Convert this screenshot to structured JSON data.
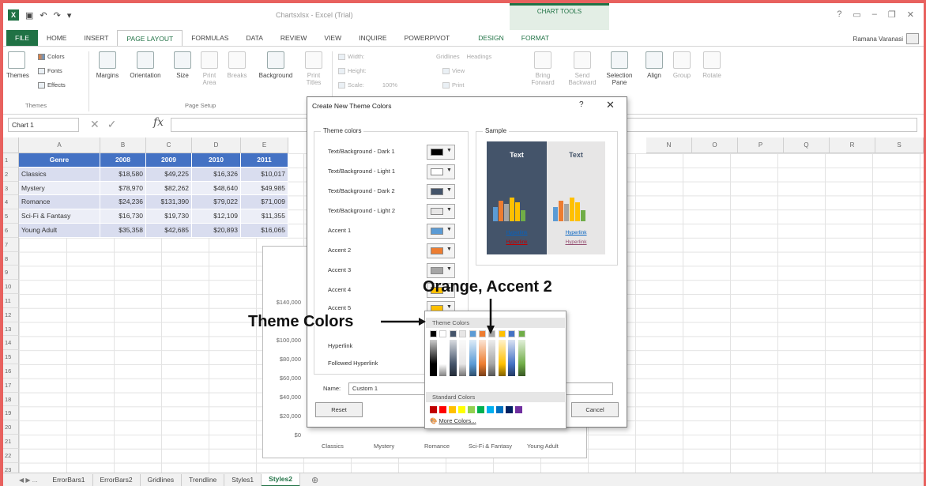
{
  "title_bar": {
    "window_title": "Chartsxlsx - Excel (Trial)",
    "chart_tools": "CHART TOOLS",
    "user": "Ramana Varanasi"
  },
  "tabs": [
    "FILE",
    "HOME",
    "INSERT",
    "PAGE LAYOUT",
    "FORMULAS",
    "DATA",
    "REVIEW",
    "VIEW",
    "INQUIRE",
    "POWERPIVOT",
    "DESIGN",
    "FORMAT"
  ],
  "ribbon": {
    "themes_label": "Themes",
    "colors": "Colors",
    "fonts": "Fonts",
    "effects": "Effects",
    "margins": "Margins",
    "orientation": "Orientation",
    "size": "Size",
    "print_area": "Print Area",
    "breaks": "Breaks",
    "background": "Background",
    "print_titles": "Print Titles",
    "page_setup_label": "Page Setup",
    "width": "Width:",
    "height": "Height:",
    "scale": "Scale:",
    "scale_value": "100%",
    "gridlines": "Gridlines",
    "headings": "Headings",
    "view": "View",
    "print": "Print",
    "bring_forward": "Bring Forward",
    "send_backward": "Send Backward",
    "selection_pane": "Selection Pane",
    "align": "Align",
    "group": "Group",
    "rotate": "Rotate"
  },
  "formula_bar": {
    "name_box": "Chart 1",
    "fx": "fx"
  },
  "columns": [
    "A",
    "B",
    "C",
    "D",
    "E",
    "",
    "",
    "",
    "",
    "",
    "",
    "",
    "",
    "",
    "N",
    "O",
    "P",
    "Q",
    "R",
    "S"
  ],
  "rows": [
    "1",
    "2",
    "3",
    "4",
    "5",
    "6",
    "7",
    "8",
    "9",
    "10",
    "11",
    "12",
    "13",
    "14",
    "15",
    "16",
    "17",
    "18",
    "19",
    "20",
    "21",
    "22",
    "23"
  ],
  "table": {
    "headers": [
      "Genre",
      "2008",
      "2009",
      "2010",
      "2011"
    ],
    "rows": [
      [
        "Classics",
        "$18,580",
        "$49,225",
        "$16,326",
        "$10,017"
      ],
      [
        "Mystery",
        "$78,970",
        "$82,262",
        "$48,640",
        "$49,985"
      ],
      [
        "Romance",
        "$24,236",
        "$131,390",
        "$79,022",
        "$71,009"
      ],
      [
        "Sci-Fi & Fantasy",
        "$16,730",
        "$19,730",
        "$12,109",
        "$11,355"
      ],
      [
        "Young Adult",
        "$35,358",
        "$42,685",
        "$20,893",
        "$16,065"
      ]
    ]
  },
  "chart": {
    "y_ticks": [
      "$140,000",
      "$100,000",
      "$80,000",
      "$60,000",
      "$40,000",
      "$20,000",
      "$0"
    ],
    "categories": [
      "Classics",
      "Mystery",
      "Romance",
      "Sci-Fi & Fantasy",
      "Young Adult"
    ]
  },
  "sheet_tabs": [
    "ErrorBars1",
    "ErrorBars2",
    "Gridlines",
    "Trendline",
    "Styles1",
    "Styles2"
  ],
  "sheet_nav": "◀ ▶ ...",
  "dialog": {
    "title": "Create New Theme Colors",
    "help": "?",
    "close": "✕",
    "theme_colors_label": "Theme colors",
    "sample_label": "Sample",
    "rows": [
      {
        "label": "Text/Background - Dark 1",
        "color": "#000000"
      },
      {
        "label": "Text/Background - Light 1",
        "color": "#ffffff"
      },
      {
        "label": "Text/Background - Dark 2",
        "color": "#44546a"
      },
      {
        "label": "Text/Background - Light 2",
        "color": "#e7e6e6"
      },
      {
        "label": "Accent 1",
        "color": "#5b9bd5"
      },
      {
        "label": "Accent 2",
        "color": "#ed7d31"
      },
      {
        "label": "Accent 3",
        "color": "#a5a5a5"
      },
      {
        "label": "Accent 4",
        "color": "#ffc000"
      },
      {
        "label": "Accent 5",
        "color": "#ffc000"
      },
      {
        "label": "Hyperlink",
        "color": "#0563c1"
      },
      {
        "label": "Followed Hyperlink",
        "color": "#954f72"
      }
    ],
    "sample_text": "Text",
    "hyperlink": "Hyperlink",
    "followed": "Hyperlink",
    "name_label": "Name:",
    "name_value": "Custom 1",
    "reset": "Reset",
    "cancel": "Cancel"
  },
  "palette": {
    "theme_header": "Theme Colors",
    "standard_header": "Standard Colors",
    "more_colors": "More Colors...",
    "theme_top": [
      "#000000",
      "#ffffff",
      "#44546a",
      "#e7e6e6",
      "#5b9bd5",
      "#ed7d31",
      "#a5a5a5",
      "#ffc000",
      "#4472c4",
      "#70ad47"
    ],
    "standard": [
      "#c00000",
      "#ff0000",
      "#ffc000",
      "#ffff00",
      "#92d050",
      "#00b050",
      "#00b0f0",
      "#0070c0",
      "#002060",
      "#7030a0"
    ]
  },
  "annotations": {
    "theme_colors": "Theme Colors",
    "orange_accent": "Orange, Accent 2"
  }
}
